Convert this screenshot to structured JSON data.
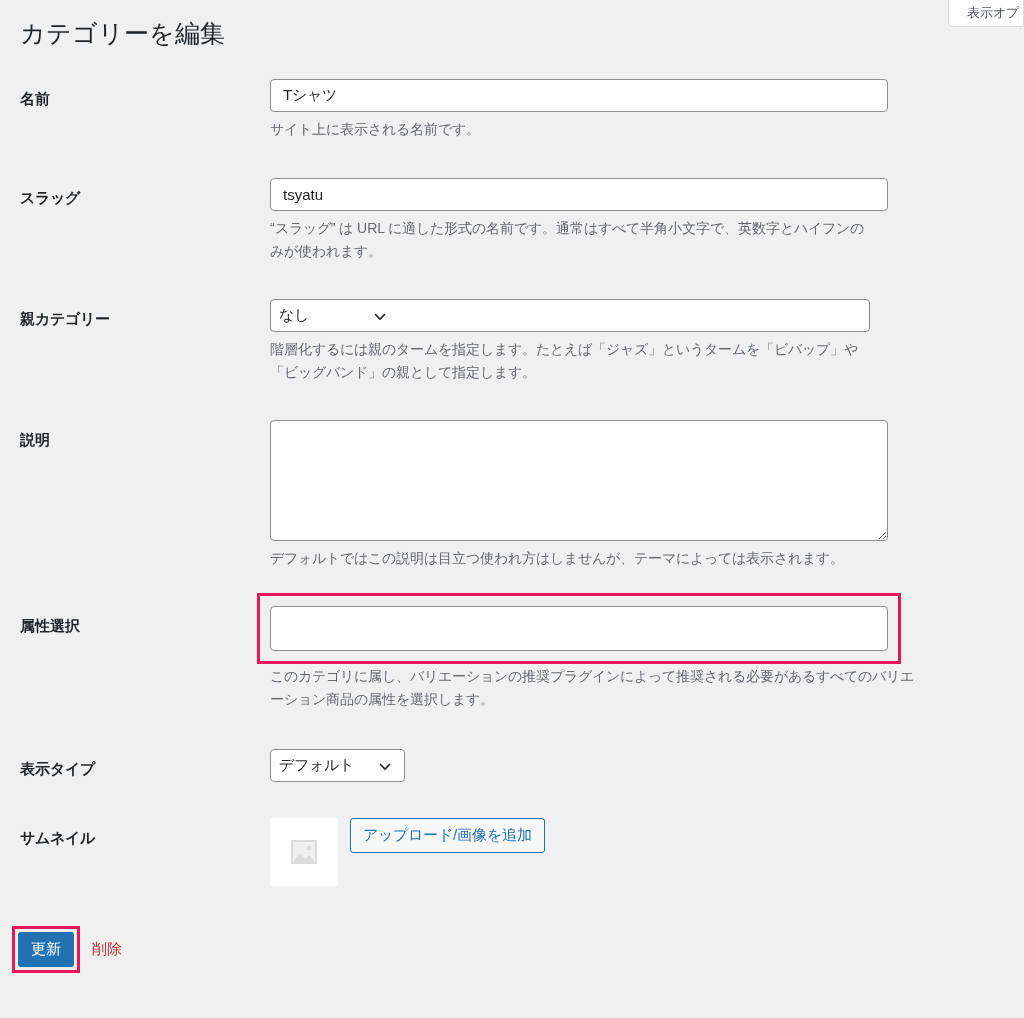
{
  "screen_options_tab": "表示オプ",
  "title": "カテゴリーを編集",
  "fields": [
    {
      "kind": "text",
      "label": "名前",
      "value": "Tシャツ",
      "description": "サイト上に表示される名前です。",
      "highlighted": false
    },
    {
      "kind": "text",
      "label": "スラッグ",
      "value": "tsyatu",
      "description": "“スラッグ” は URL に適した形式の名前です。通常はすべて半角小文字で、英数字とハイフンのみが使われます。",
      "highlighted": false
    },
    {
      "kind": "select",
      "label": "親カテゴリー",
      "value": "なし",
      "description": "階層化するには親のタームを指定します。たとえば「ジャズ」というタームを「ビバップ」や「ビッグバンド」の親として指定します。",
      "highlighted": false
    },
    {
      "kind": "textarea",
      "label": "説明",
      "description": "デフォルトではこの説明は目立つ使われ方はしませんが、テーマによっては表示されます。",
      "highlighted": false
    },
    {
      "kind": "text",
      "label": "属性選択",
      "description": "このカテゴリに属し、バリエーションの推奨プラグインによって推奨される必要があるすべてのバリエーション商品の属性を選択します。",
      "highlighted": true
    },
    {
      "kind": "select",
      "label": "表示タイプ",
      "value": "デフォルト",
      "highlighted": false
    },
    {
      "kind": "image",
      "label": "サムネイル",
      "button": "アップロード/画像を追加",
      "highlighted": false
    }
  ],
  "update_button": {
    "label": "更新",
    "highlighted": true
  },
  "delete_link": "削除"
}
